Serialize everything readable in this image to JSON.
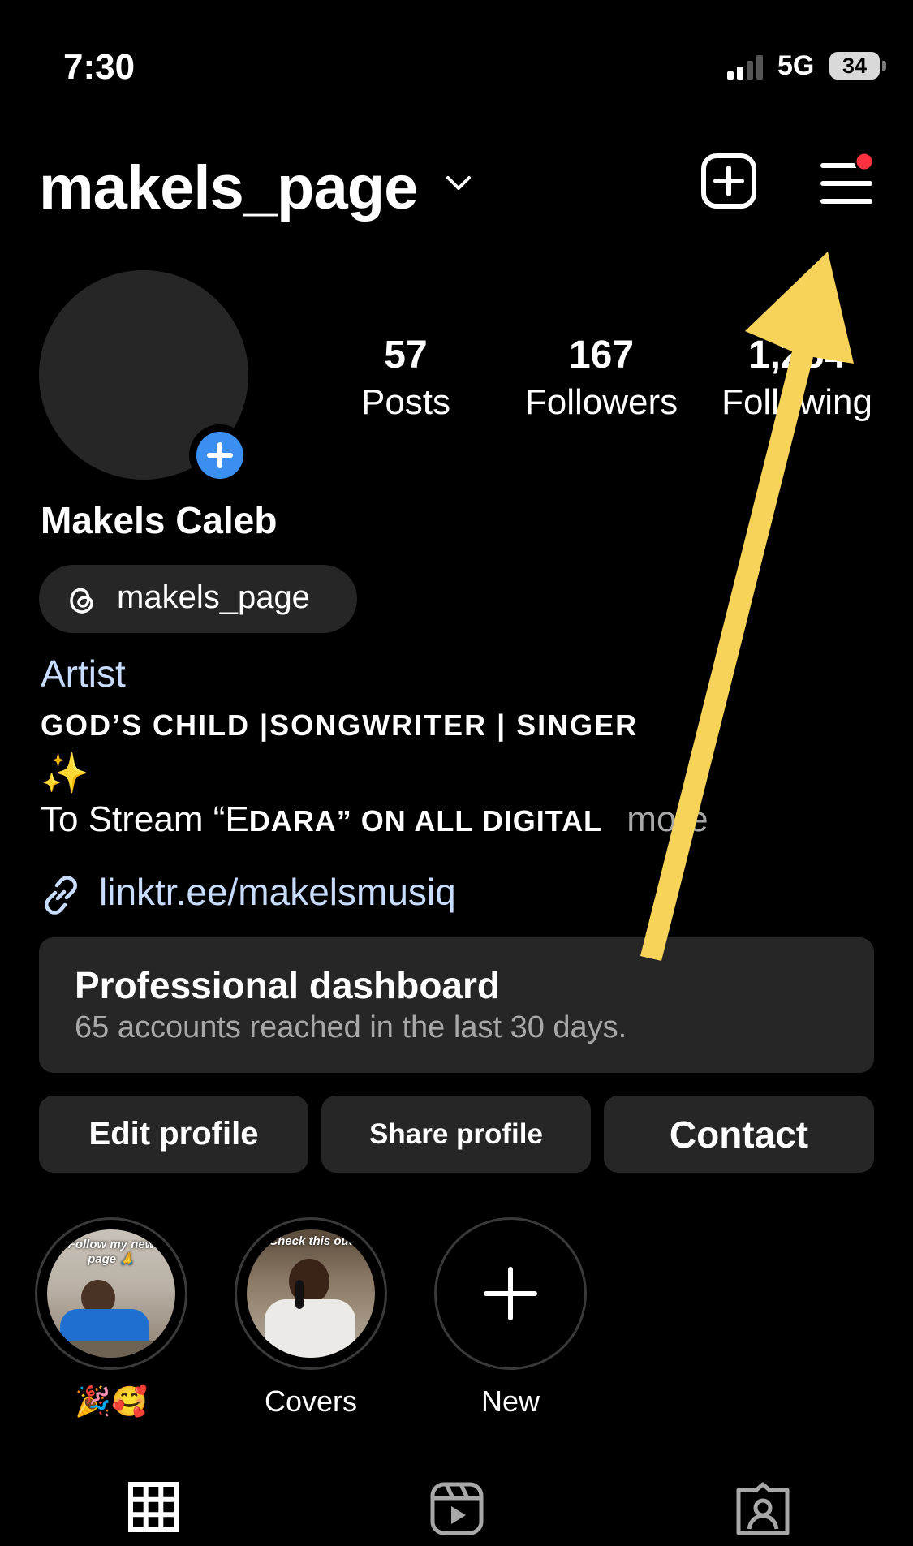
{
  "status_bar": {
    "time": "7:30",
    "network": "5G",
    "battery": "34"
  },
  "header": {
    "username": "makels_page"
  },
  "stats": [
    {
      "value": "57",
      "label": "Posts"
    },
    {
      "value": "167",
      "label": "Followers"
    },
    {
      "value": "1,254",
      "label": "Following"
    }
  ],
  "profile": {
    "name": "Makels Caleb",
    "threads_handle": "makels_page",
    "category": "Artist",
    "bio_line1": "GOD’S CHILD |SONGWRITER | SINGER",
    "bio_emoji": "✨",
    "bio_line2_start": "To Stream “E",
    "bio_line2_sc": "DARA” ON ALL DIGITAL",
    "bio_more": "more",
    "link": "linktr.ee/makelsmusiq"
  },
  "dashboard": {
    "title": "Professional dashboard",
    "subtitle": "65 accounts reached in the last 30 days."
  },
  "buttons": {
    "edit": "Edit profile",
    "share": "Share profile",
    "contact": "Contact"
  },
  "highlights": [
    {
      "label": "🎉🥰",
      "cover_text": "Follow my new page 🙏"
    },
    {
      "label": "Covers",
      "cover_text": "Check this out"
    },
    {
      "label": "New"
    }
  ],
  "colors": {
    "accent_blue": "#3b8ff0",
    "notification_red": "#ff3040",
    "arrow_yellow": "#f7d35a",
    "link_blue": "#c8dcff"
  },
  "icons": [
    "chevron-down-icon",
    "new-post-icon",
    "menu-icon",
    "threads-icon",
    "link-icon",
    "grid-icon",
    "reels-icon",
    "tagged-icon"
  ]
}
